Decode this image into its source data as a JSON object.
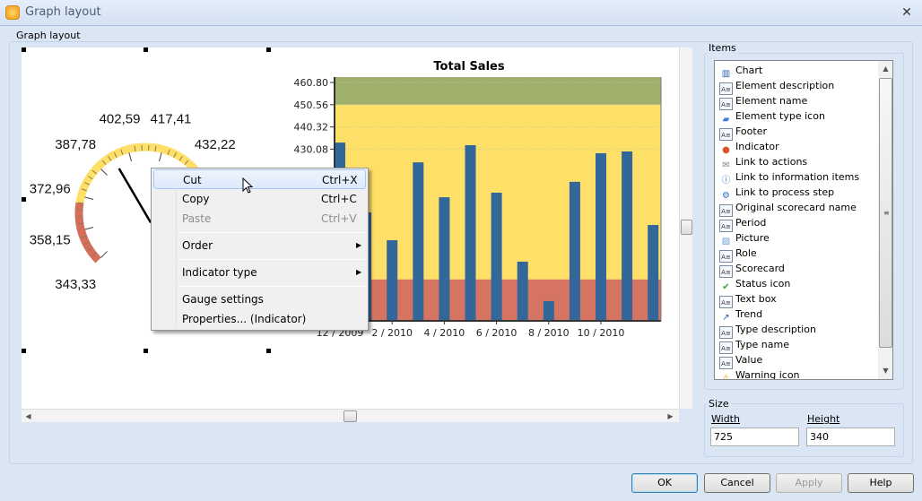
{
  "window": {
    "title": "Graph layout",
    "close_icon": "close-icon"
  },
  "layout_group": {
    "label": "Graph layout"
  },
  "gauge": {
    "labels": [
      "343,33",
      "358,15",
      "372,96",
      "387,78",
      "402,59",
      "417,41",
      "432,22"
    ],
    "needle_value": 395,
    "colors": {
      "red": "#d66e5c",
      "yellow": "#fedf68"
    }
  },
  "chart_data": {
    "type": "bar",
    "title": "Total Sales",
    "categories": [
      "12 / 2009",
      "1 / 2010",
      "2 / 2010",
      "3 / 2010",
      "4 / 2010",
      "5 / 2010",
      "6 / 2010",
      "7 / 2010",
      "8 / 2010",
      "9 / 2010",
      "10 / 2010",
      "11 / 2010",
      "12 / 2010"
    ],
    "visible_x_labels": [
      "12 / 2009",
      "2 / 2010",
      "4 / 2010",
      "6 / 2010",
      "8 / 2010",
      "10 / 2010"
    ],
    "values": [
      433.1,
      400.9,
      388.1,
      424.0,
      407.9,
      431.9,
      410.0,
      378.2,
      360.0,
      415.0,
      428.2,
      429.0,
      395.1
    ],
    "y_ticks": [
      "460.80",
      "450.56",
      "440.32",
      "430.08"
    ],
    "ylim": [
      350.9,
      463.3
    ],
    "bands": [
      {
        "from": 450.56,
        "to": 463.3,
        "color": "#9fb06c"
      },
      {
        "from": 370,
        "to": 450.56,
        "color": "#fedf68"
      },
      {
        "from": 350.9,
        "to": 370,
        "color": "#d67462"
      }
    ],
    "bar_color": "#336699",
    "grid": true
  },
  "context_menu": {
    "items": [
      {
        "label": "Cut",
        "shortcut": "Ctrl+X"
      },
      {
        "label": "Copy",
        "shortcut": "Ctrl+C"
      },
      {
        "label": "Paste",
        "shortcut": "Ctrl+V"
      },
      {
        "label": "Order"
      },
      {
        "label": "Indicator type"
      },
      {
        "label": "Gauge settings"
      },
      {
        "label": "Properties... (Indicator)"
      }
    ]
  },
  "items_group": {
    "label": "Items",
    "items": [
      {
        "label": "Chart",
        "icon": "chart-icon"
      },
      {
        "label": "Element description",
        "icon": "text-icon"
      },
      {
        "label": "Element name",
        "icon": "text-icon"
      },
      {
        "label": "Element type icon",
        "icon": "ruler-icon"
      },
      {
        "label": "Footer",
        "icon": "text-icon"
      },
      {
        "label": "Indicator",
        "icon": "gauge-icon"
      },
      {
        "label": "Link to actions",
        "icon": "envelope-icon"
      },
      {
        "label": "Link to information items",
        "icon": "info-icon"
      },
      {
        "label": "Link to process step",
        "icon": "gear-icon"
      },
      {
        "label": "Original scorecard name",
        "icon": "text-icon"
      },
      {
        "label": "Period",
        "icon": "text-icon"
      },
      {
        "label": "Picture",
        "icon": "picture-icon"
      },
      {
        "label": "Role",
        "icon": "text-icon"
      },
      {
        "label": "Scorecard",
        "icon": "text-icon"
      },
      {
        "label": "Status icon",
        "icon": "checkmark-icon"
      },
      {
        "label": "Text box",
        "icon": "text-icon"
      },
      {
        "label": "Trend",
        "icon": "trend-icon"
      },
      {
        "label": "Type description",
        "icon": "text-icon"
      },
      {
        "label": "Type name",
        "icon": "text-icon"
      },
      {
        "label": "Value",
        "icon": "text-icon"
      },
      {
        "label": "Warning icon",
        "icon": "warning-icon"
      }
    ]
  },
  "size_group": {
    "label": "Size",
    "width_label": "Width",
    "height_label": "Height",
    "width_value": "725",
    "height_value": "340"
  },
  "buttons": {
    "ok": "OK",
    "cancel": "Cancel",
    "apply": "Apply",
    "help": "Help"
  }
}
